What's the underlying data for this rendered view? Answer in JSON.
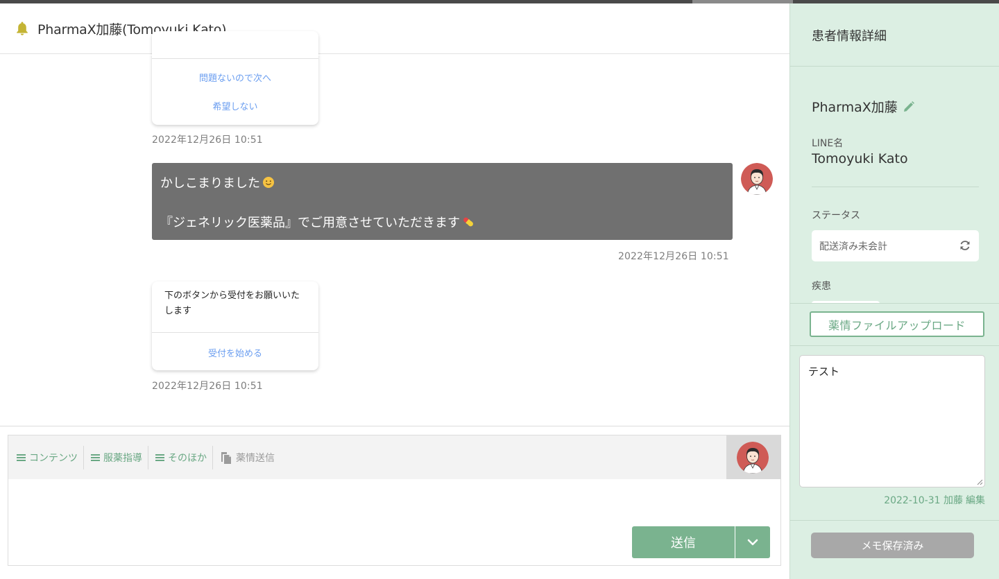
{
  "chat": {
    "title": "PharmaX加藤(Tomoyuki Kato)"
  },
  "messages": {
    "card1": {
      "buttons": [
        "問題ないので次へ",
        "希望しない"
      ],
      "time": "2022年12月26日 10:51"
    },
    "bubble": {
      "line1": "かしこまりました",
      "line2": "『ジェネリック医薬品』でご用意させていただきます",
      "time": "2022年12月26日 10:51"
    },
    "card2": {
      "text": "下のボタンから受付をお願いいたします",
      "button": "受付を始める",
      "time": "2022年12月26日 10:51"
    }
  },
  "composer": {
    "tools": [
      {
        "label": "コンテンツ",
        "icon": "menu-lines-icon"
      },
      {
        "label": "服薬指導",
        "icon": "menu-lines-icon"
      },
      {
        "label": "そのほか",
        "icon": "menu-lines-icon"
      },
      {
        "label": "薬情送信",
        "icon": "document-copy-icon"
      }
    ],
    "send_label": "送信"
  },
  "panel": {
    "title": "患者情報詳細",
    "patient_name": "PharmaX加藤",
    "line_label": "LINE名",
    "line_name": "Tomoyuki Kato",
    "status_label": "ステータス",
    "status_value": "配送済み未会計",
    "disease_label": "疾患",
    "upload_label": "薬情ファイルアップロード",
    "memo_text": "テスト",
    "memo_date": "2022-10-31 加藤",
    "memo_edit": "編集",
    "saved_label": "メモ保存済み"
  },
  "colors": {
    "accent_green": "#7ab38f",
    "panel_bg": "#dcefe3",
    "link_blue": "#6b9ef0",
    "bubble_gray": "#707070"
  }
}
